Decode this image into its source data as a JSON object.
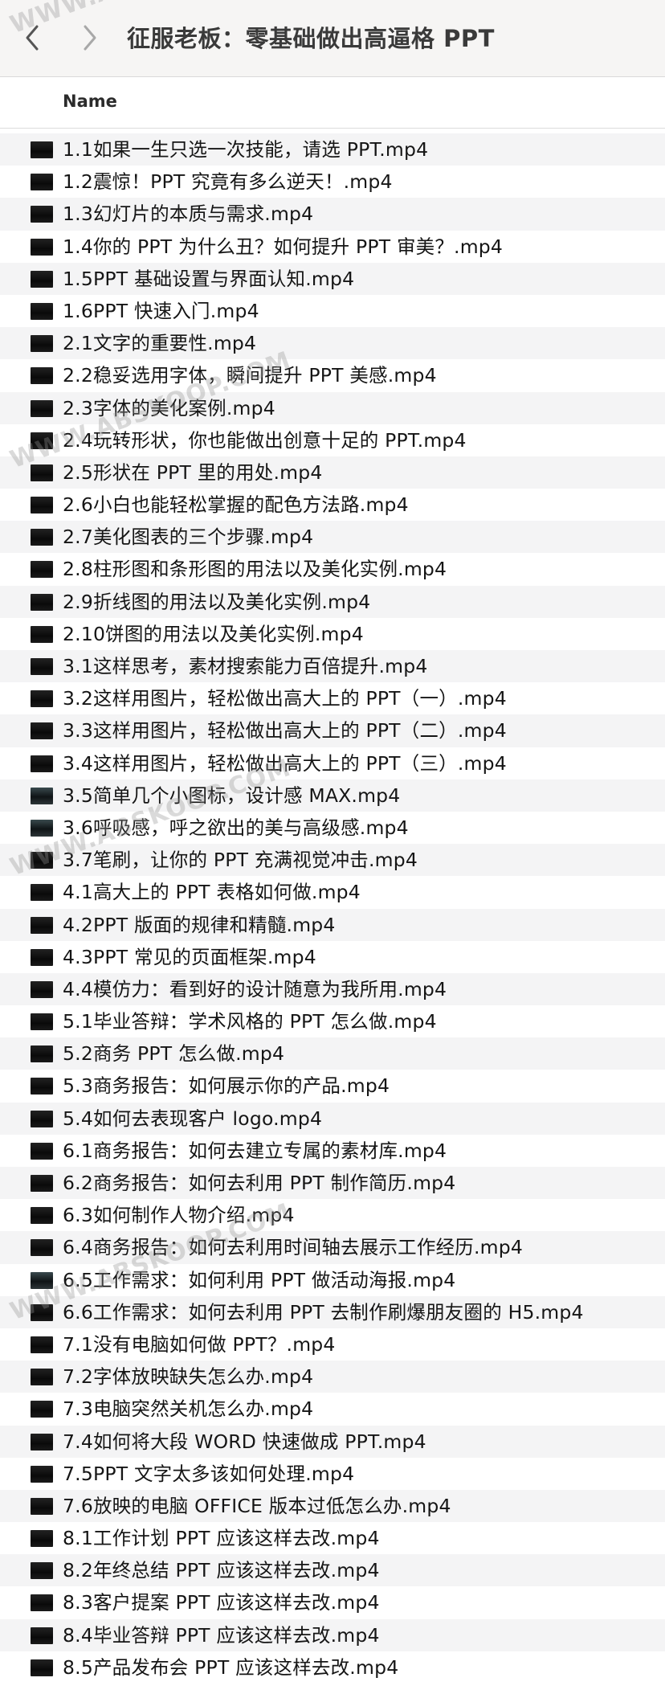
{
  "window": {
    "title": "征服老板：零基础做出高逼格 PPT",
    "back_icon": "chevron-left-icon",
    "forward_icon": "chevron-right-icon"
  },
  "list_header": {
    "name_label": "Name"
  },
  "files": [
    {
      "name": "1.1如果一生只选一次技能，请选 PPT.mp4"
    },
    {
      "name": "1.2震惊！PPT 究竟有多么逆天！.mp4"
    },
    {
      "name": "1.3幻灯片的本质与需求.mp4"
    },
    {
      "name": "1.4你的 PPT 为什么丑？如何提升 PPT 审美？.mp4"
    },
    {
      "name": "1.5PPT 基础设置与界面认知.mp4"
    },
    {
      "name": "1.6PPT 快速入门.mp4"
    },
    {
      "name": "2.1文字的重要性.mp4"
    },
    {
      "name": "2.2稳妥选用字体，瞬间提升 PPT 美感.mp4"
    },
    {
      "name": "2.3字体的美化案例.mp4"
    },
    {
      "name": "2.4玩转形状，你也能做出创意十足的 PPT.mp4"
    },
    {
      "name": "2.5形状在 PPT 里的用处.mp4"
    },
    {
      "name": "2.6小白也能轻松掌握的配色方法路.mp4"
    },
    {
      "name": "2.7美化图表的三个步骤.mp4"
    },
    {
      "name": "2.8柱形图和条形图的用法以及美化实例.mp4"
    },
    {
      "name": "2.9折线图的用法以及美化实例.mp4"
    },
    {
      "name": "2.10饼图的用法以及美化实例.mp4"
    },
    {
      "name": "3.1这样思考，素材搜索能力百倍提升.mp4"
    },
    {
      "name": "3.2这样用图片，轻松做出高大上的 PPT（一）.mp4"
    },
    {
      "name": "3.3这样用图片，轻松做出高大上的 PPT（二）.mp4"
    },
    {
      "name": "3.4这样用图片，轻松做出高大上的 PPT（三）.mp4"
    },
    {
      "name": "3.5简单几个小图标，设计感 MAX.mp4"
    },
    {
      "name": "3.6呼吸感，呼之欲出的美与高级感.mp4"
    },
    {
      "name": "3.7笔刷，让你的 PPT 充满视觉冲击.mp4"
    },
    {
      "name": "4.1高大上的 PPT 表格如何做.mp4"
    },
    {
      "name": "4.2PPT 版面的规律和精髓.mp4"
    },
    {
      "name": "4.3PPT 常见的页面框架.mp4"
    },
    {
      "name": "4.4模仿力：看到好的设计随意为我所用.mp4"
    },
    {
      "name": "5.1毕业答辩：学术风格的 PPT 怎么做.mp4"
    },
    {
      "name": "5.2商务 PPT 怎么做.mp4"
    },
    {
      "name": "5.3商务报告：如何展示你的产品.mp4"
    },
    {
      "name": "5.4如何去表现客户 logo.mp4"
    },
    {
      "name": "6.1商务报告：如何去建立专属的素材库.mp4"
    },
    {
      "name": "6.2商务报告：如何去利用 PPT 制作简历.mp4"
    },
    {
      "name": "6.3如何制作人物介绍.mp4"
    },
    {
      "name": "6.4商务报告：如何去利用时间轴去展示工作经历.mp4"
    },
    {
      "name": "6.5工作需求：如何利用 PPT 做活动海报.mp4"
    },
    {
      "name": "6.6工作需求：如何去利用 PPT 去制作刷爆朋友圈的 H5.mp4"
    },
    {
      "name": "7.1没有电脑如何做 PPT？.mp4"
    },
    {
      "name": "7.2字体放映缺失怎么办.mp4"
    },
    {
      "name": "7.3电脑突然关机怎么办.mp4"
    },
    {
      "name": "7.4如何将大段 WORD 快速做成 PPT.mp4"
    },
    {
      "name": "7.5PPT 文字太多该如何处理.mp4"
    },
    {
      "name": "7.6放映的电脑 OFFICE 版本过低怎么办.mp4"
    },
    {
      "name": "8.1工作计划 PPT 应该这样去改.mp4"
    },
    {
      "name": "8.2年终总结 PPT 应该这样去改.mp4"
    },
    {
      "name": "8.3客户提案 PPT 应该这样去改.mp4"
    },
    {
      "name": "8.4毕业答辩 PPT 应该这样去改.mp4"
    },
    {
      "name": "8.5产品发布会 PPT 应该这样去改.mp4"
    }
  ],
  "watermarks": [
    {
      "text": "WWW.ABSKOOP.COM"
    },
    {
      "text": "WWW.ABSKOOP.COM"
    },
    {
      "text": "WWW.ABSKOOP.COM"
    },
    {
      "text": "WWW.ABSKOOP.COM"
    }
  ]
}
